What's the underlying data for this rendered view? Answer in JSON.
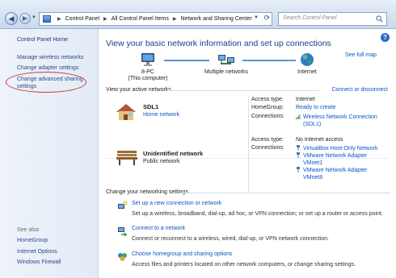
{
  "address_bar": {
    "crumbs": [
      "Control Panel",
      "All Control Panel Items",
      "Network and Sharing Center"
    ],
    "search_placeholder": "Search Control Panel"
  },
  "sidebar": {
    "home": "Control Panel Home",
    "links": [
      "Manage wireless networks",
      "Change adapter settings",
      "Change advanced sharing settings"
    ],
    "see_also_label": "See also",
    "see_also": [
      "HomeGroup",
      "Internet Options",
      "Windows Firewall"
    ]
  },
  "main": {
    "title": "View your basic network information and set up connections",
    "see_full_map": "See full map",
    "map": {
      "pc_name": "8-PC",
      "pc_sub": "(This computer)",
      "middle": "Multiple networks",
      "internet": "Internet"
    },
    "active_heading": "View your active networks",
    "connect_disconnect": "Connect or disconnect",
    "networks": [
      {
        "name": "SDL1",
        "type": "Home network",
        "access_type_label": "Access type:",
        "access_type": "Internet",
        "homegroup_label": "HomeGroup:",
        "homegroup": "Ready to create",
        "connections_label": "Connections:",
        "connections": [
          "Wireless Network Connection",
          "(SDL1)"
        ]
      },
      {
        "name": "Unidentified network",
        "type": "Public network",
        "access_type_label": "Access type:",
        "access_type": "No Internet access",
        "connections_label": "Connections:",
        "connections": [
          "VirtualBox Host-Only Network",
          "VMware Network Adapter",
          "VMnet1",
          "VMware Network Adapter",
          "VMnet8"
        ]
      }
    ],
    "change_heading": "Change your networking settings",
    "tasks": [
      {
        "title": "Set up a new connection or network",
        "desc": "Set up a wireless, broadband, dial-up, ad hoc, or VPN connection; or set up a router or access point."
      },
      {
        "title": "Connect to a network",
        "desc": "Connect or reconnect to a wireless, wired, dial-up, or VPN network connection."
      },
      {
        "title": "Choose homegroup and sharing options",
        "desc": "Access files and printers located on other network computers, or change sharing settings."
      }
    ]
  },
  "colors": {
    "link": "#0b55c4",
    "title": "#163f8a",
    "highlight_ring": "#c63a3a"
  }
}
